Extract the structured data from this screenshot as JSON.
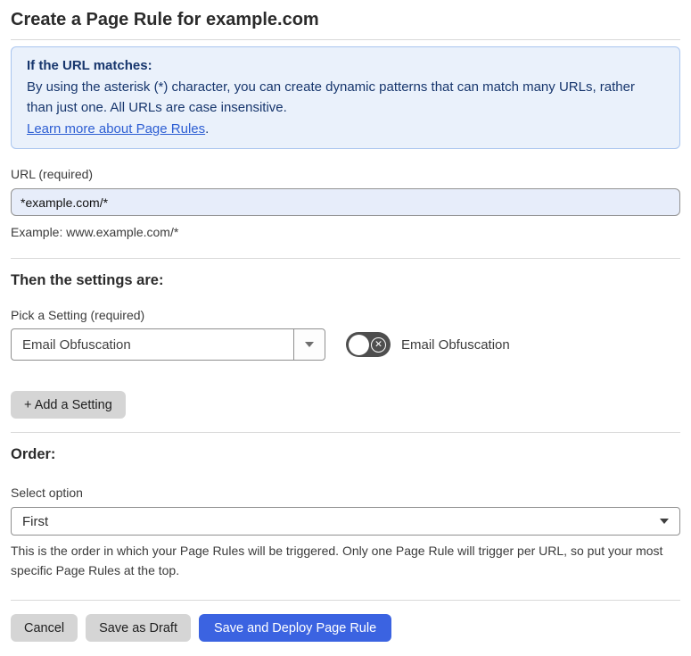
{
  "page": {
    "title": "Create a Page Rule for example.com"
  },
  "info_box": {
    "heading": "If the URL matches:",
    "body": "By using the asterisk (*) character, you can create dynamic patterns that can match many URLs, rather than just one. All URLs are case insensitive.",
    "link_label": "Learn more about Page Rules",
    "link_suffix": "."
  },
  "url_field": {
    "label": "URL (required)",
    "value": "*example.com/*",
    "helper": "Example: www.example.com/*"
  },
  "settings_section": {
    "heading": "Then the settings are:",
    "pick_label": "Pick a Setting (required)",
    "dropdown_value": "Email Obfuscation",
    "dropdown_arrow_icon": "chevron-down",
    "toggle_label": "Email Obfuscation",
    "toggle_state": "off",
    "toggle_off_icon": "✕",
    "add_button_label": "+ Add a Setting"
  },
  "order_section": {
    "heading": "Order:",
    "select_label": "Select option",
    "select_value": "First",
    "helper": "This is the order in which your Page Rules will be triggered. Only one Page Rule will trigger per URL, so put your most specific Page Rules at the top."
  },
  "footer": {
    "cancel_label": "Cancel",
    "save_draft_label": "Save as Draft",
    "save_deploy_label": "Save and Deploy Page Rule"
  },
  "colors": {
    "accent_blue": "#3b63e1",
    "info_bg": "#eaf1fb",
    "info_border": "#a9c5ef",
    "info_text": "#17366d",
    "link_blue": "#2d5ed3",
    "input_bg": "#e7edfa",
    "button_gray": "#d5d5d5",
    "toggle_bg": "#4e4e4e",
    "divider": "#d9d9d9"
  }
}
